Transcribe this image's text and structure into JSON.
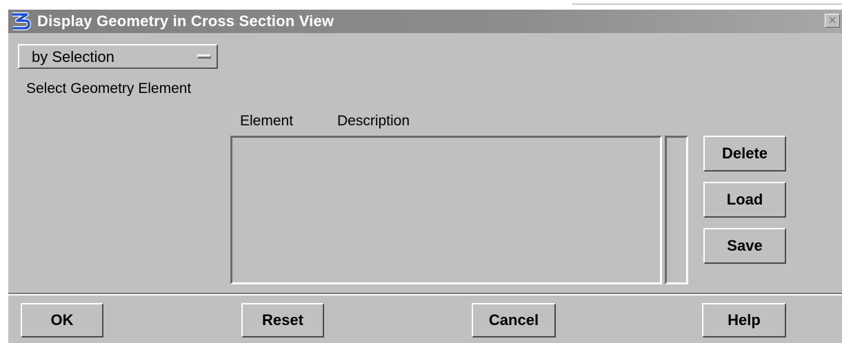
{
  "window": {
    "title": "Display Geometry in Cross Section View",
    "close_symbol": "✕",
    "icon": "app-logo-icon"
  },
  "mode_select": {
    "selected": "by Selection",
    "icon": "option-menu-indicator-icon"
  },
  "instructions": "Select Geometry Element",
  "element_list": {
    "columns": [
      "Element",
      "Description"
    ],
    "rows": []
  },
  "side_buttons": {
    "delete": "Delete",
    "load": "Load",
    "save": "Save"
  },
  "footer_buttons": {
    "ok": "OK",
    "reset": "Reset",
    "cancel": "Cancel",
    "help": "Help"
  },
  "colors": {
    "dialog_bg": "#c0c0c0",
    "titlebar": "#808080",
    "title_text": "#ffffff",
    "icon_blue": "#1a4fd8"
  }
}
